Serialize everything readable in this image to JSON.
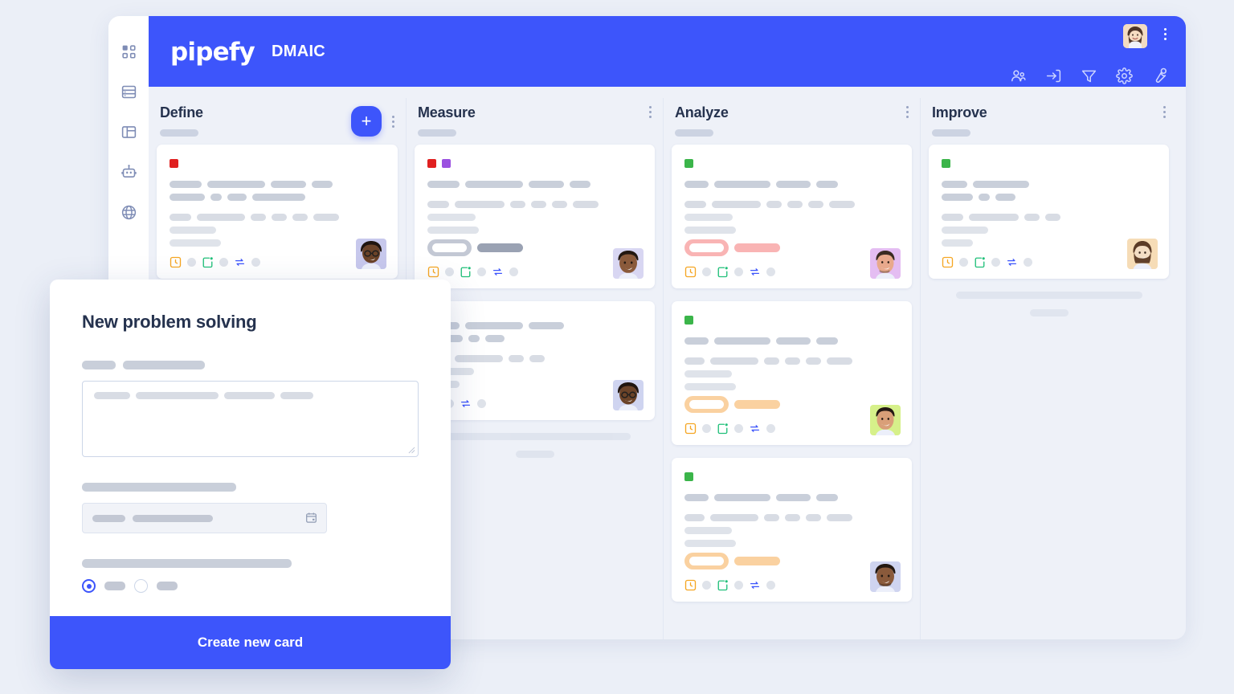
{
  "app": {
    "brand": "pipefy",
    "pipe_title": "DMAIC",
    "accent_color": "#3d55fb",
    "page_bg": "#ebeff7",
    "board_bg": "#eef1f8"
  },
  "sidebar": {
    "items": [
      {
        "name": "dashboard-grid",
        "icon": "grid-icon"
      },
      {
        "name": "database",
        "icon": "database-icon"
      },
      {
        "name": "layout-panel",
        "icon": "layout-panel-icon"
      },
      {
        "name": "automation-bot",
        "icon": "robot-icon"
      },
      {
        "name": "portal-globe",
        "icon": "globe-icon"
      }
    ]
  },
  "header": {
    "avatar": {
      "name": "user-avatar",
      "skin": "#f2d9be"
    },
    "kebab": "more-options",
    "tools": [
      {
        "name": "members-icon",
        "icon": "people"
      },
      {
        "name": "import-icon",
        "icon": "inbox-arrow"
      },
      {
        "name": "filter-icon",
        "icon": "funnel"
      },
      {
        "name": "settings-icon",
        "icon": "gear"
      },
      {
        "name": "automations-icon",
        "icon": "wrench"
      }
    ]
  },
  "board": {
    "add_card_label": "+",
    "columns": [
      {
        "title": "Define",
        "has_add_button": true,
        "cards": [
          {
            "labels": [
              "#e02020"
            ],
            "badge": null,
            "avatar_bg": "#c7c8ec",
            "footer_icons": [
              "clock-square-icon",
              "checklist-square-icon",
              "connection-icon"
            ]
          }
        ],
        "ghost_bars": []
      },
      {
        "title": "Measure",
        "has_add_button": false,
        "cards": [
          {
            "labels": [
              "#e02020",
              "#9b51e0"
            ],
            "badge": "#c3c8d4",
            "avatar_bg": "#d8d6f2",
            "footer_icons": [
              "clock-square-icon",
              "checklist-square-icon",
              "connection-icon"
            ]
          },
          {
            "labels": [],
            "badge": null,
            "avatar_bg": "#cfd4f0",
            "footer_icons": [
              "checklist-square-icon",
              "connection-icon"
            ]
          }
        ],
        "ghost_bars": [
          "long",
          "short"
        ]
      },
      {
        "title": "Analyze",
        "has_add_button": false,
        "cards": [
          {
            "labels": [
              "#3bb54a"
            ],
            "badge": "#f9b4b4",
            "avatar_bg": "#e4bdf2",
            "footer_icons": [
              "clock-square-icon",
              "checklist-square-icon",
              "connection-icon"
            ]
          },
          {
            "labels": [
              "#3bb54a"
            ],
            "badge": "#fad1a0",
            "avatar_bg": "#d6f08a",
            "footer_icons": [
              "clock-square-icon",
              "checklist-square-icon",
              "connection-icon"
            ]
          },
          {
            "labels": [
              "#3bb54a"
            ],
            "badge": "#fad1a0",
            "avatar_bg": "#cfd4f0",
            "footer_icons": [
              "clock-square-icon",
              "checklist-square-icon",
              "connection-icon"
            ]
          }
        ],
        "ghost_bars": []
      },
      {
        "title": "Improve",
        "has_add_button": false,
        "cards": [
          {
            "labels": [
              "#3bb54a"
            ],
            "badge": null,
            "avatar_bg": "#f6dcb6",
            "footer_icons": [
              "clock-square-icon",
              "checklist-square-icon",
              "connection-icon"
            ]
          }
        ],
        "ghost_bars": [
          "long",
          "short"
        ]
      }
    ]
  },
  "modal": {
    "title": "New problem solving",
    "description_field": {
      "name": "description-textarea",
      "value": "",
      "placeholder": ""
    },
    "date_field": {
      "name": "due-date-input",
      "value": "",
      "placeholder": "",
      "icon": "calendar-icon"
    },
    "radio_group": {
      "name": "priority-radio-group",
      "options": [
        {
          "label": "",
          "selected": true
        },
        {
          "label": "",
          "selected": false
        }
      ]
    },
    "submit_label": "Create new card"
  }
}
